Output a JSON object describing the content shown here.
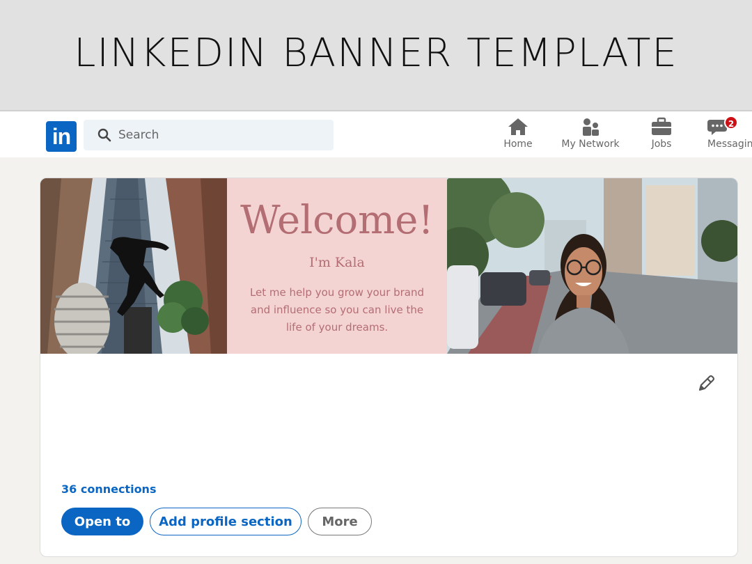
{
  "header": {
    "title": "LINKEDIN BANNER TEMPLATE"
  },
  "navbar": {
    "logo_text": "in",
    "search": {
      "placeholder": "Search",
      "value": ""
    },
    "items": [
      {
        "label": "Home",
        "icon": "home-icon"
      },
      {
        "label": "My Network",
        "icon": "network-icon"
      },
      {
        "label": "Jobs",
        "icon": "briefcase-icon"
      },
      {
        "label": "Messagin",
        "icon": "messaging-icon",
        "badge": "2"
      }
    ]
  },
  "banner": {
    "headline": "Welcome!",
    "greeting": "I'm Kala",
    "tagline": "Let me help you grow your brand and influence so you can live the life of your dreams."
  },
  "profile": {
    "connections": "36 connections",
    "buttons": {
      "open_to": "Open to",
      "add_section": "Add profile section",
      "more": "More"
    }
  },
  "colors": {
    "linkedin_blue": "#0a66c2",
    "banner_pink": "#f4d3d3",
    "banner_text": "#b36e73",
    "badge_red": "#cc1016"
  }
}
